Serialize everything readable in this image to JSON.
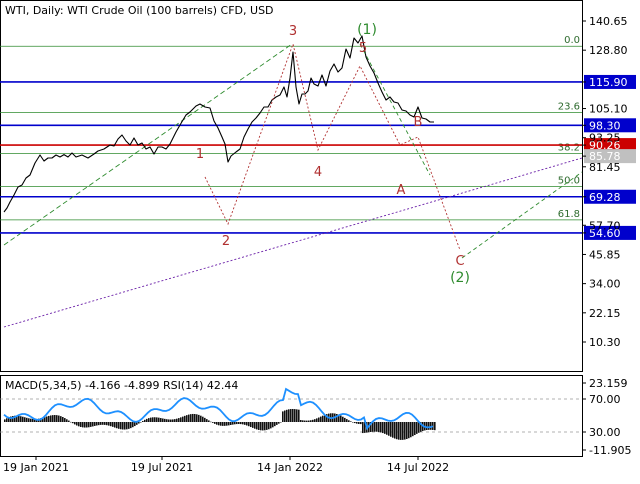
{
  "header": {
    "title": "WTI, Daily:  WTI Crude Oil (100 barrels) CFD, USD"
  },
  "macd_panel": {
    "label": "MACD(5,34,5) -4.166 -4.899 RSI(14) 42.44",
    "y_ticks": [
      "23.159",
      "70.00",
      "30.00",
      "-11.905"
    ]
  },
  "colors": {
    "price_line": "#000000",
    "blue_level": "#0000cc",
    "red_level": "#cc0000",
    "fib_green": "#2e8b2e",
    "wave_red": "#b03030",
    "wave_green": "#2e8b2e",
    "trend_purple": "#6a1fa8",
    "rsi": "#1e90ff"
  },
  "chart_data": {
    "type": "line",
    "y_axis": {
      "ticks": [
        140.65,
        128.8,
        115.9,
        105.1,
        98.3,
        93.25,
        90.26,
        85.78,
        81.45,
        69.28,
        57.7,
        54.6,
        45.85,
        34.0,
        22.15,
        10.3
      ]
    },
    "x_axis": {
      "tick_labels": [
        "19 Jan 2021",
        "19 Jul 2021",
        "14 Jan 2022",
        "14 Jul 2022"
      ]
    },
    "level_labels": {
      "blue": [
        "115.90",
        "98.30",
        "69.28",
        "54.60"
      ],
      "red": "90.26",
      "current": "85.78"
    },
    "horizontal_levels": [
      {
        "value": 115.9,
        "label": "115.90",
        "color": "#0000cc"
      },
      {
        "value": 98.3,
        "label": "98.30",
        "color": "#0000cc"
      },
      {
        "value": 90.26,
        "label": "90.26",
        "color": "#cc0000"
      },
      {
        "value": 69.28,
        "label": "69.28",
        "color": "#0000cc"
      },
      {
        "value": 54.6,
        "label": "54.60",
        "color": "#0000cc"
      }
    ],
    "fibonacci": [
      {
        "ratio": "0.0",
        "value": 130.4
      },
      {
        "ratio": "23.6",
        "value": 103.5
      },
      {
        "ratio": "38.2",
        "value": 86.8
      },
      {
        "ratio": "50.0",
        "value": 73.4
      },
      {
        "ratio": "61.8",
        "value": 59.9
      }
    ],
    "wave_labels": [
      {
        "text": "1",
        "color": "red"
      },
      {
        "text": "2",
        "color": "red"
      },
      {
        "text": "3",
        "color": "red"
      },
      {
        "text": "4",
        "color": "red"
      },
      {
        "text": "5",
        "color": "red"
      },
      {
        "text": "(1)",
        "color": "green"
      },
      {
        "text": "A",
        "color": "red"
      },
      {
        "text": "B",
        "color": "red"
      },
      {
        "text": "C",
        "color": "red"
      },
      {
        "text": "(2)",
        "color": "green"
      }
    ]
  }
}
